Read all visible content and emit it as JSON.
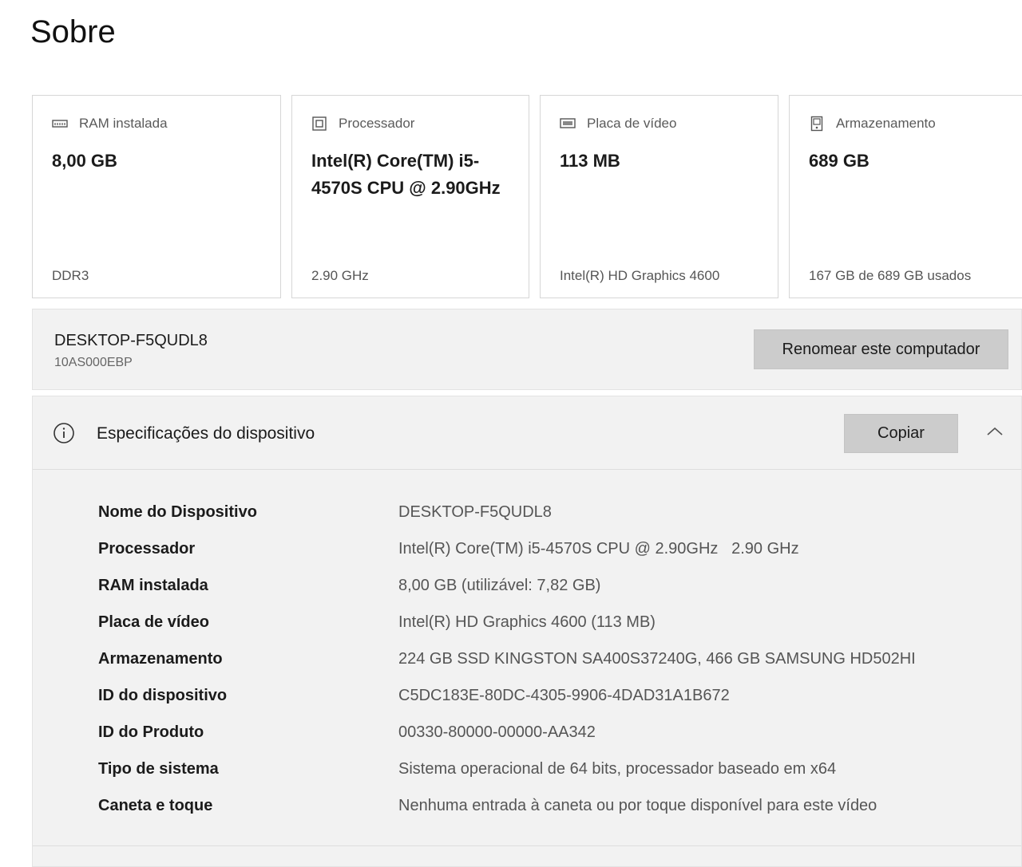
{
  "page": {
    "title": "Sobre"
  },
  "cards": [
    {
      "icon": "ram-icon",
      "label": "RAM instalada",
      "value": "8,00 GB",
      "detail": "DDR3"
    },
    {
      "icon": "processor-icon",
      "label": "Processador",
      "value": "Intel(R) Core(TM) i5-4570S CPU @ 2.90GHz",
      "detail": "2.90 GHz"
    },
    {
      "icon": "graphics-card-icon",
      "label": "Placa de vídeo",
      "value": "113 MB",
      "detail": "Intel(R) HD Graphics 4600"
    },
    {
      "icon": "storage-icon",
      "label": "Armazenamento",
      "value": "689 GB",
      "detail": "167 GB de 689 GB usados"
    }
  ],
  "computer": {
    "name": "DESKTOP-F5QUDL8",
    "model": "10AS000EBP",
    "rename_label": "Renomear este computador"
  },
  "specs": {
    "title": "Especificações do dispositivo",
    "copy_label": "Copiar",
    "expanded": true,
    "rows": [
      {
        "key": "Nome do Dispositivo",
        "value": "DESKTOP-F5QUDL8"
      },
      {
        "key": "Processador",
        "value": "Intel(R) Core(TM) i5-4570S CPU @ 2.90GHz   2.90 GHz"
      },
      {
        "key": "RAM instalada",
        "value": "8,00 GB (utilizável: 7,82 GB)"
      },
      {
        "key": "Placa de vídeo",
        "value": "Intel(R) HD Graphics 4600 (113 MB)"
      },
      {
        "key": "Armazenamento",
        "value": "224 GB SSD KINGSTON SA400S37240G, 466 GB SAMSUNG HD502HI"
      },
      {
        "key": "ID do dispositivo",
        "value": "C5DC183E-80DC-4305-9906-4DAD31A1B672"
      },
      {
        "key": "ID do Produto",
        "value": "00330-80000-00000-AA342"
      },
      {
        "key": "Tipo de sistema",
        "value": "Sistema operacional de 64 bits, processador baseado em x64"
      },
      {
        "key": "Caneta e toque",
        "value": "Nenhuma entrada à caneta ou por toque disponível para este vídeo"
      }
    ]
  }
}
